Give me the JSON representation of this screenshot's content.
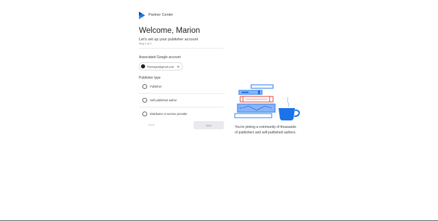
{
  "brand": {
    "name": "Partner Center",
    "icon": "partner-center-logo-icon",
    "accent": "#1a73e8"
  },
  "header": {
    "welcome": "Welcome, Marion",
    "subtitle": "Let's set up your publisher account",
    "step": "Step 1 of 2"
  },
  "account": {
    "label": "Associated Google account",
    "email": "Rioniaget@gmail.com",
    "avatar_icon": "avatar-icon",
    "dropdown_icon": "chevron-down-icon"
  },
  "publisher_type": {
    "label": "Publisher type",
    "options": [
      {
        "label": "Publisher"
      },
      {
        "label": "Self published author"
      },
      {
        "label": "Distributor or service provider"
      }
    ]
  },
  "actions": {
    "back_label": "Back",
    "next_label": "Next"
  },
  "side": {
    "caption": "You're joining a community of thousands of publishers and self-published authors.",
    "illustration_icon": "books-and-mug-icon"
  }
}
